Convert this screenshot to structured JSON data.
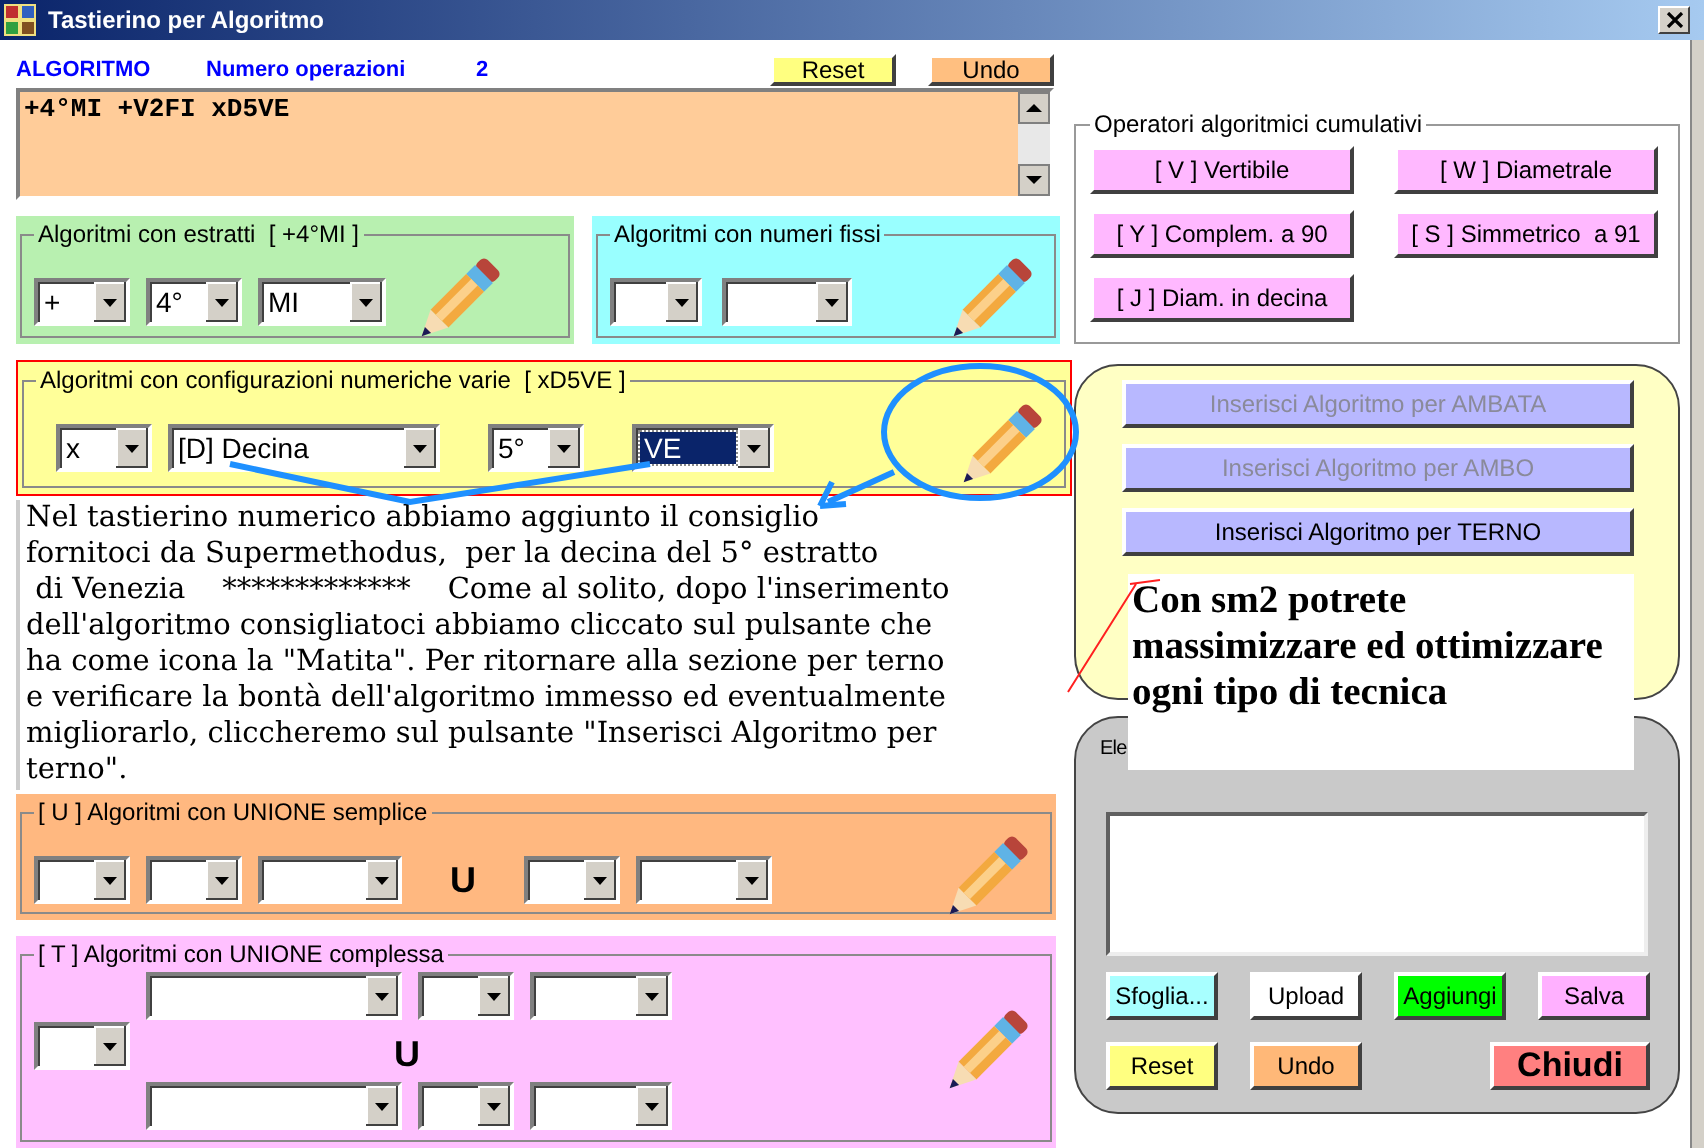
{
  "window": {
    "title": "Tastierino per Algoritmo"
  },
  "header": {
    "algorithm_label": "ALGORITMO",
    "operations_label": "Numero operazioni",
    "operations_count": "2",
    "buttons": [
      {
        "label": "Reset",
        "color": "#ffff80"
      },
      {
        "label": "Undo",
        "color": "#ffbf80"
      }
    ]
  },
  "expression": {
    "value": "+4°MI +V2FI xD5VE"
  },
  "extracted_group": {
    "title": "Algoritmi con estratti  [ +4°MI ]",
    "selects": [
      {
        "value": "+",
        "focused": false
      },
      {
        "value": "4°",
        "focused": false
      },
      {
        "value": "MI",
        "focused": false
      }
    ]
  },
  "fixed_group": {
    "title": "Algoritmi con numeri fissi",
    "selects": [
      {
        "focused": false
      },
      {
        "focused": false
      }
    ]
  },
  "config_group": {
    "title": "Algoritmi con configurazioni numeriche varie  [ xD5VE ]",
    "selects": [
      {
        "value": "x",
        "focused": false
      },
      {
        "value": "[D] Decina",
        "focused": false
      },
      {
        "value": "5°",
        "focused": false
      },
      {
        "value": "VE",
        "focused": true
      }
    ]
  },
  "note": {
    "text": "Nel tastierino numerico abbiamo aggiunto il consiglio\nfornitoci da Supermethodus,  per la decina del 5° estratto\n di Venezia    *************    Come al solito, dopo l'inserimento\ndell'algoritmo consigliatoci abbiamo cliccato sul pulsante che\nha come icona la \"Matita\". Per ritornare alla sezione per terno\ne verificare la bontà dell'algoritmo immesso ed eventualmente\nmigliorarlo, cliccheremo sul pulsante \"Inserisci Algoritmo per\nterno\"."
  },
  "union_simple": {
    "title": "[ U ] Algoritmi con UNIONE semplice",
    "left_selects": [
      {
        "focused": false
      },
      {
        "focused": false
      },
      {
        "focused": false
      }
    ],
    "union": "U",
    "right_selects": [
      {
        "focused": false
      },
      {
        "focused": false
      }
    ]
  },
  "union_complex": {
    "title": "[ T ] Algoritmi con UNIONE complessa",
    "first_select": {
      "focused": false
    },
    "top_selects": [
      {
        "focused": false
      },
      {
        "focused": false
      },
      {
        "focused": false
      }
    ],
    "union": "U",
    "bottom_selects": [
      {
        "focused": false
      },
      {
        "focused": false
      },
      {
        "focused": false
      }
    ]
  },
  "operators": {
    "title": "Operatori algoritmici cumulativi",
    "buttons": [
      "[ V ] Vertibile",
      "[ W ] Diametrale",
      "[ Y ] Complem. a 90",
      "[ S ] Simmetrico  a 91",
      "[ J ] Diam. in decina"
    ]
  },
  "insert_buttons": [
    {
      "label": "Inserisci Algoritmo per AMBATA",
      "disabled": true
    },
    {
      "label": "Inserisci Algoritmo per AMBO",
      "disabled": true
    },
    {
      "label": "Inserisci Algoritmo per TERNO",
      "disabled": false
    }
  ],
  "file_panel": {
    "label": "Ele",
    "buttons": [
      {
        "label": "Sfoglia...",
        "color": "#a8ffff",
        "kind": "small"
      },
      {
        "label": "Upload",
        "color": "#ffffff",
        "kind": "small"
      },
      {
        "label": "Aggiungi",
        "color": "#00ff00",
        "kind": "small"
      },
      {
        "label": "Salva",
        "color": "#ffb0ff",
        "kind": "small"
      },
      {
        "label": "Reset",
        "color": "#ffff80",
        "kind": "small"
      },
      {
        "label": "Undo",
        "color": "#ffb878",
        "kind": "small"
      },
      {
        "label": "Chiudi",
        "color": "#ff8080",
        "kind": "large"
      }
    ]
  },
  "callout": {
    "text": "Con sm2 potrete massimizzare ed ottimizzare ogni tipo di tecnica"
  }
}
